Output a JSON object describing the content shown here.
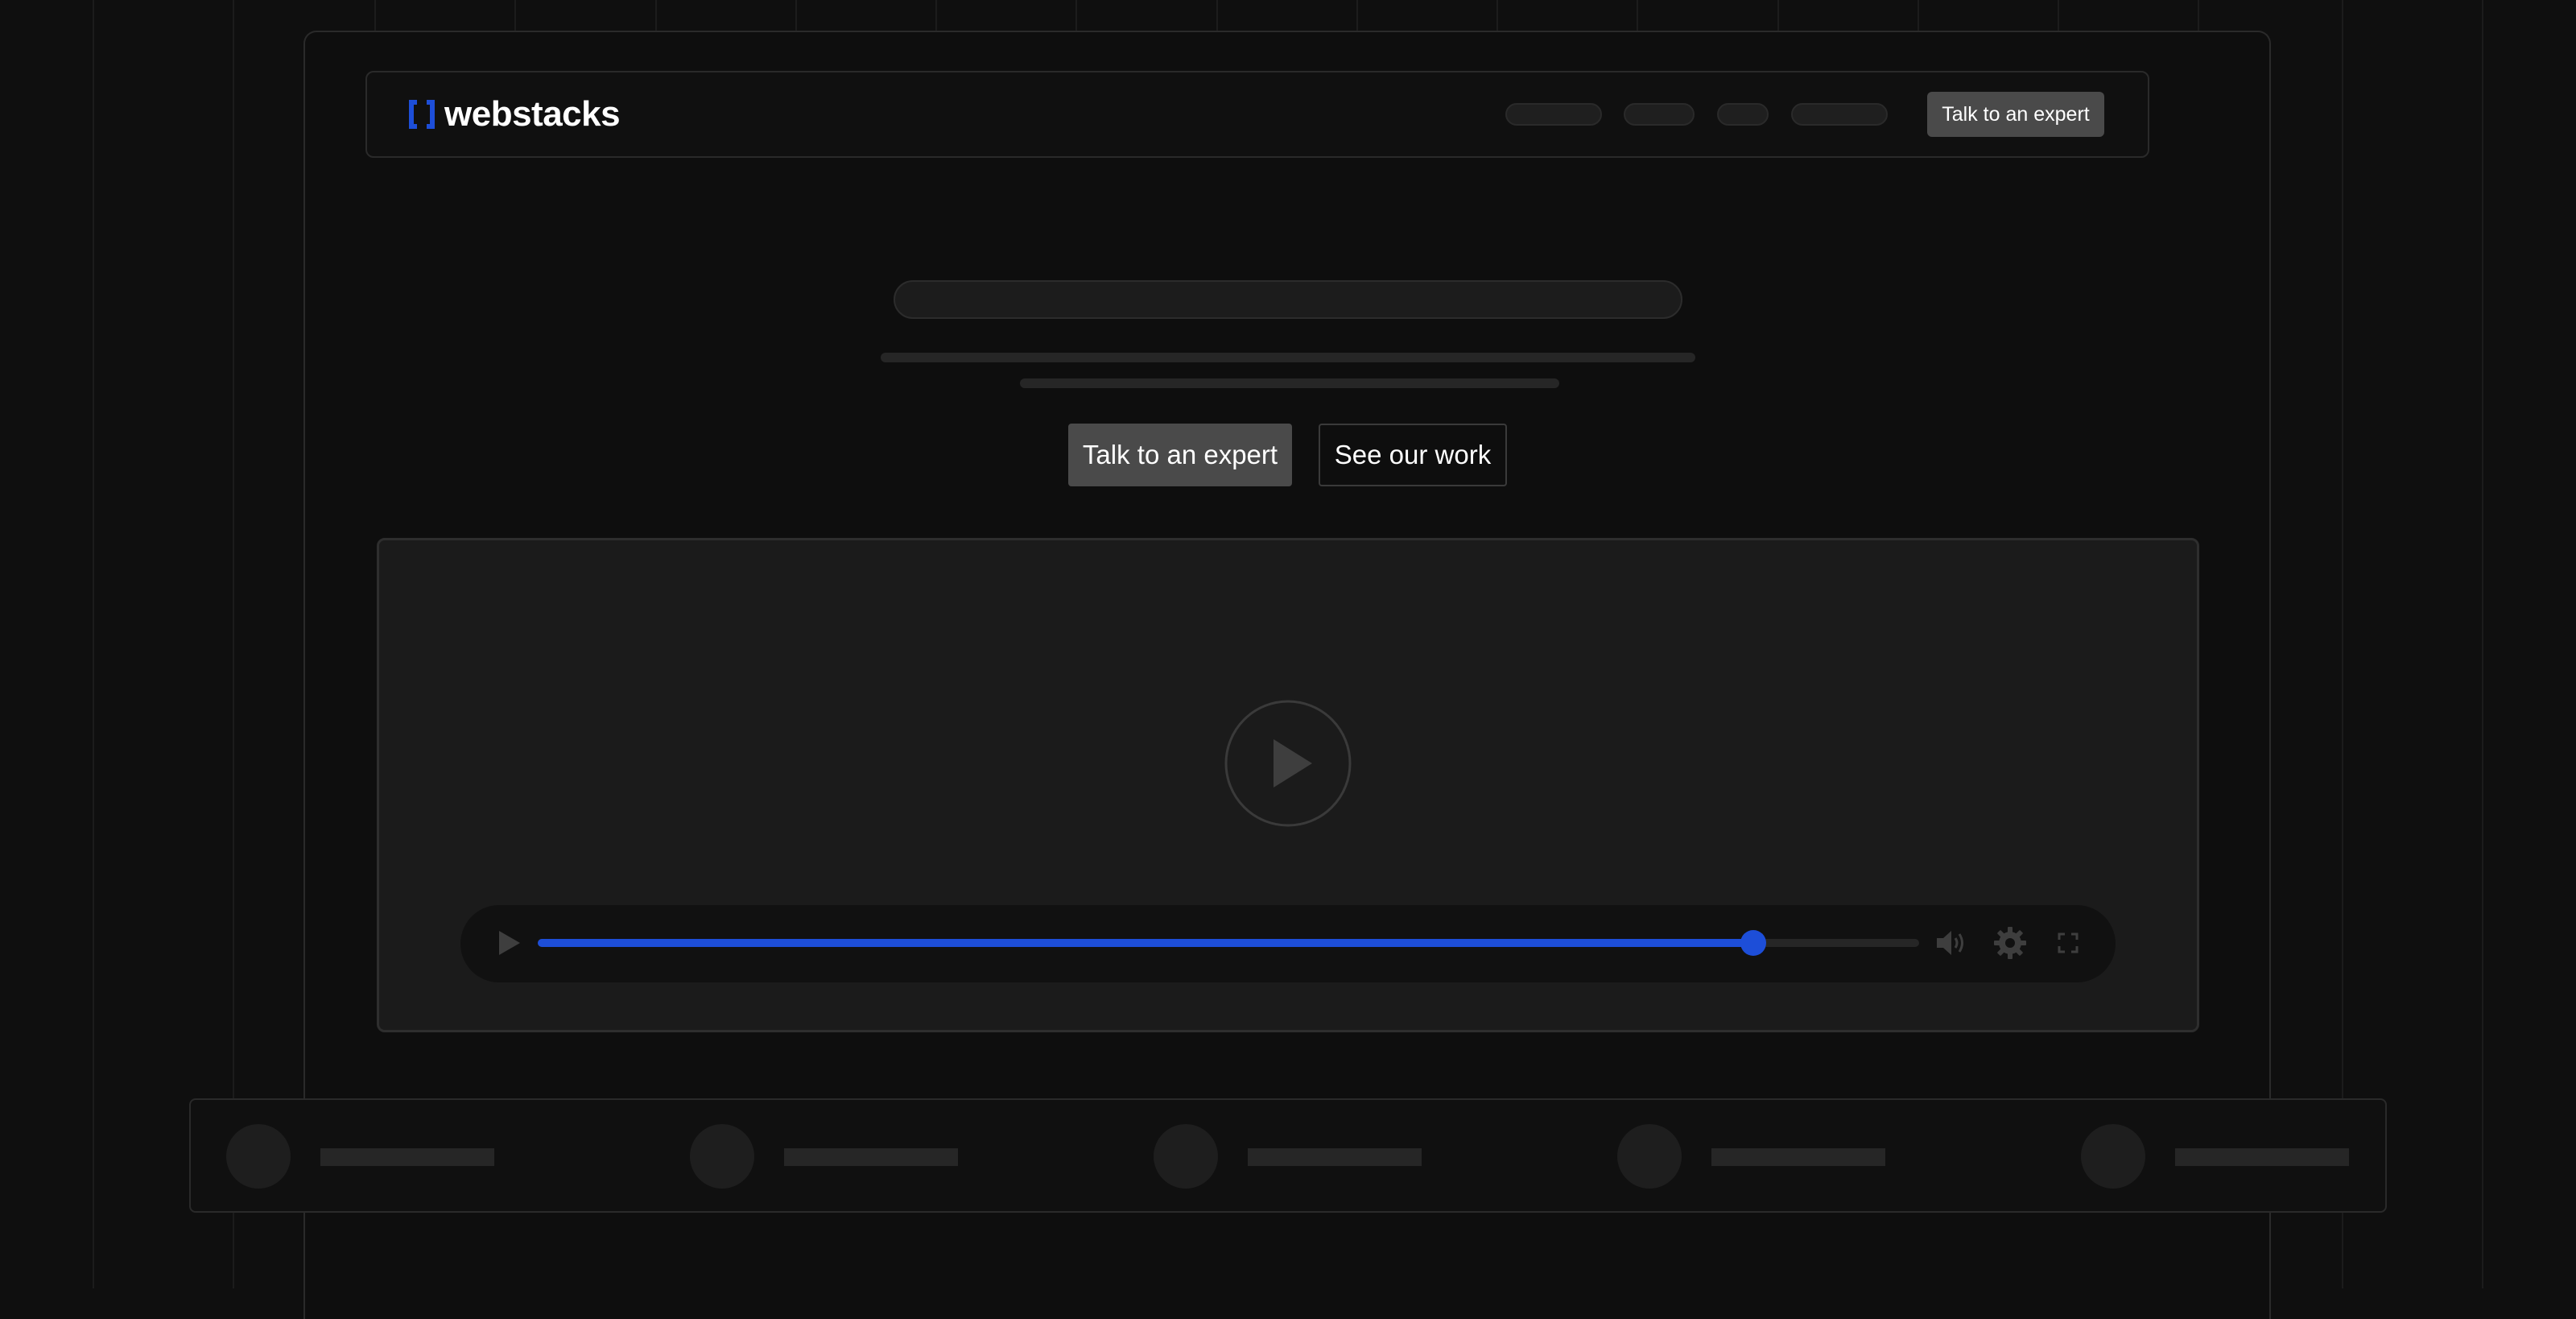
{
  "brand": {
    "name": "webstacks",
    "accent_color": "#1d4ed8"
  },
  "nav": {
    "cta_label": "Talk to an expert"
  },
  "hero": {
    "primary_label": "Talk to an expert",
    "secondary_label": "See our work"
  },
  "video": {
    "progress_fraction": 0.88,
    "icons": [
      "play-icon",
      "volume-icon",
      "settings-icon",
      "fullscreen-icon"
    ]
  },
  "logo_bar": {
    "item_count": 5
  }
}
